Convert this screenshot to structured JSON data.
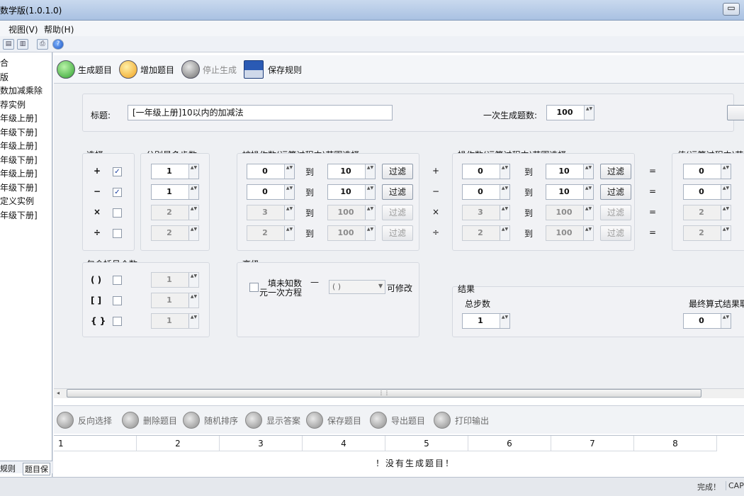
{
  "app": {
    "title": "数学版(1.0.1.0)",
    "minimize": "▭"
  },
  "menu": {
    "view": "视图(V)",
    "help": "帮助(H)"
  },
  "sidebar": {
    "items": [
      "合",
      "版",
      "数加减乘除",
      "荐实例",
      "年级上册]",
      "年级下册]",
      "年级上册]",
      "年级下册]",
      "年级上册]",
      "年级下册]",
      "定义实例",
      "年级下册]"
    ],
    "tabs": [
      "规则",
      "题目保"
    ]
  },
  "actions": {
    "generate": "生成题目",
    "add": "增加题目",
    "stop": "停止生成",
    "save_rule": "保存规则"
  },
  "form": {
    "title_label": "标题:",
    "title_value": "[一年级上册]10以内的加减法",
    "count_label": "一次生成题数:",
    "count_value": "100",
    "select_label": "选择",
    "steps_label": "分别最多步数",
    "operand_label": "被操作数(运算过程中)范围选择",
    "operator_label": "操作数(运算过程中)范围选择",
    "value_label": "值(运算过程中)范",
    "to": "到",
    "filter": "过滤",
    "eq": "=",
    "ops": [
      {
        "sym": "+",
        "checked": true,
        "steps": "1",
        "a_from": "0",
        "a_to": "10",
        "b_from": "0",
        "b_to": "10",
        "v": "0"
      },
      {
        "sym": "−",
        "checked": true,
        "steps": "1",
        "a_from": "0",
        "a_to": "10",
        "b_from": "0",
        "b_to": "10",
        "v": "0"
      },
      {
        "sym": "×",
        "checked": false,
        "steps": "2",
        "a_from": "3",
        "a_to": "100",
        "b_from": "3",
        "b_to": "100",
        "v": "2"
      },
      {
        "sym": "÷",
        "checked": false,
        "steps": "2",
        "a_from": "2",
        "a_to": "100",
        "b_from": "2",
        "b_to": "100",
        "v": "2"
      }
    ],
    "brackets_label": "包含括号个数",
    "brackets": [
      {
        "sym": "( )",
        "v": "1"
      },
      {
        "sym": "[ ]",
        "v": "1"
      },
      {
        "sym": "{ }",
        "v": "1"
      }
    ],
    "advanced_label": "高级",
    "advanced_line1": "填未知数",
    "advanced_line2": "元一次方程",
    "advanced_dash": "—",
    "advanced_select": "( )",
    "advanced_mod": "可修改",
    "result_label": "结果",
    "total_steps_label": "总步数",
    "total_steps": "1",
    "final_label": "最终算式结果取",
    "final_value": "0"
  },
  "bottom": {
    "invert": "反向选择",
    "delete": "删除题目",
    "shuffle": "随机排序",
    "show": "显示答案",
    "save": "保存题目",
    "export": "导出题目",
    "print": "打印输出"
  },
  "grid": {
    "headers": [
      "1",
      "2",
      "3",
      "4",
      "5",
      "6",
      "7",
      "8"
    ],
    "empty": "！没有生成题目！"
  },
  "status": {
    "done": "完成！",
    "cap": "CAP"
  },
  "colors": {
    "accent_green": "#2fa12f",
    "accent_orange": "#f0a01c",
    "window_bar": "#a9c1e2"
  }
}
